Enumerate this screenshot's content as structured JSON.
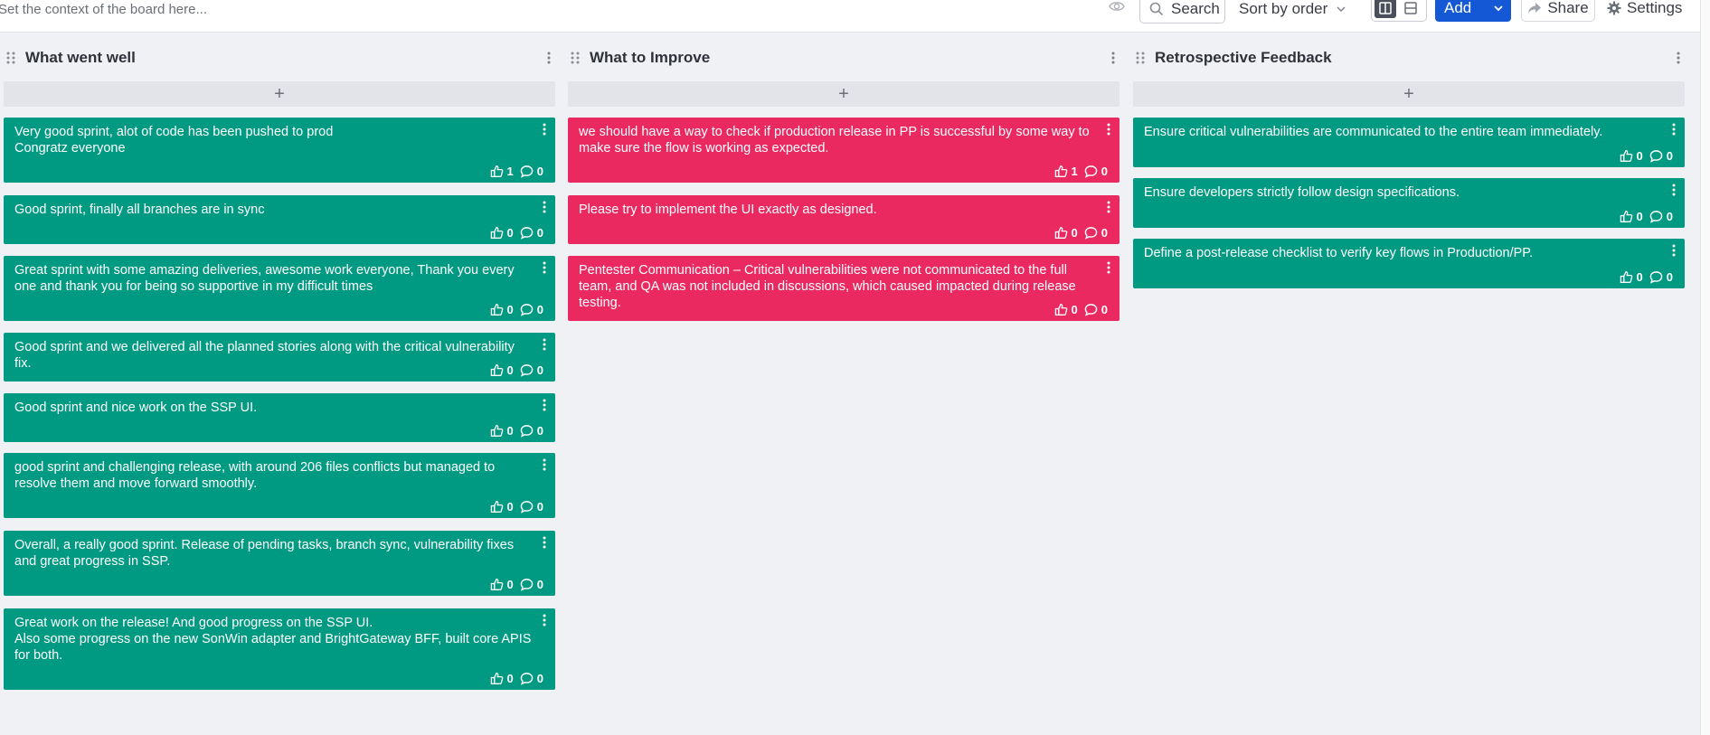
{
  "topbar": {
    "context_placeholder": "Set the context of the board here...",
    "search_label": "Search",
    "sort_label": "Sort by order",
    "add_label": "Add",
    "share_label": "Share",
    "settings_label": "Settings"
  },
  "colors": {
    "green_card": "#009a83",
    "red_card": "#e9295f",
    "add_button": "#1558d6"
  },
  "columns": [
    {
      "title": "What went well",
      "add_symbol": "+",
      "cards": [
        {
          "text": "Very good sprint, alot of code has been pushed to prod\nCongratz everyone",
          "likes": "1",
          "comments": "0"
        },
        {
          "text": "Good sprint, finally all branches are in sync",
          "likes": "0",
          "comments": "0"
        },
        {
          "text": "Great sprint with some amazing deliveries, awesome work everyone, Thank you every one and thank you for being so supportive in my difficult times",
          "likes": "0",
          "comments": "0"
        },
        {
          "text": "Good sprint and we delivered all the planned stories along with the critical vulnerability fix.",
          "likes": "0",
          "comments": "0"
        },
        {
          "text": "Good sprint and nice work on the SSP UI.",
          "likes": "0",
          "comments": "0"
        },
        {
          "text": "good sprint and challenging release, with around 206 files conflicts but managed to resolve them and move forward smoothly.",
          "likes": "0",
          "comments": "0"
        },
        {
          "text": "Overall, a really good sprint. Release of pending tasks, branch sync, vulnerability fixes and great progress in SSP.",
          "likes": "0",
          "comments": "0"
        },
        {
          "text": "Great work on the release! And good progress on the SSP UI.\nAlso some progress on the new SonWin adapter and BrightGateway BFF, built core APIS for both.",
          "likes": "0",
          "comments": "0"
        }
      ]
    },
    {
      "title": "What to Improve",
      "add_symbol": "+",
      "cards": [
        {
          "text": "we should have a way to check if production release in PP is successful by some way to make sure the flow is working as expected.",
          "likes": "1",
          "comments": "0"
        },
        {
          "text": "Please try to implement the UI exactly as designed.",
          "likes": "0",
          "comments": "0"
        },
        {
          "text": "Pentester Communication – Critical vulnerabilities were not communicated to the full team, and QA was not included in discussions, which caused impacted during release testing.",
          "likes": "0",
          "comments": "0"
        }
      ]
    },
    {
      "title": "Retrospective Feedback",
      "add_symbol": "+",
      "cards": [
        {
          "text": "Ensure critical vulnerabilities are communicated to the entire team immediately.",
          "likes": "0",
          "comments": "0"
        },
        {
          "text": "Ensure developers strictly follow design specifications.",
          "likes": "0",
          "comments": "0"
        },
        {
          "text": "Define a post-release checklist to verify key flows in Production/PP.",
          "likes": "0",
          "comments": "0"
        }
      ]
    }
  ]
}
